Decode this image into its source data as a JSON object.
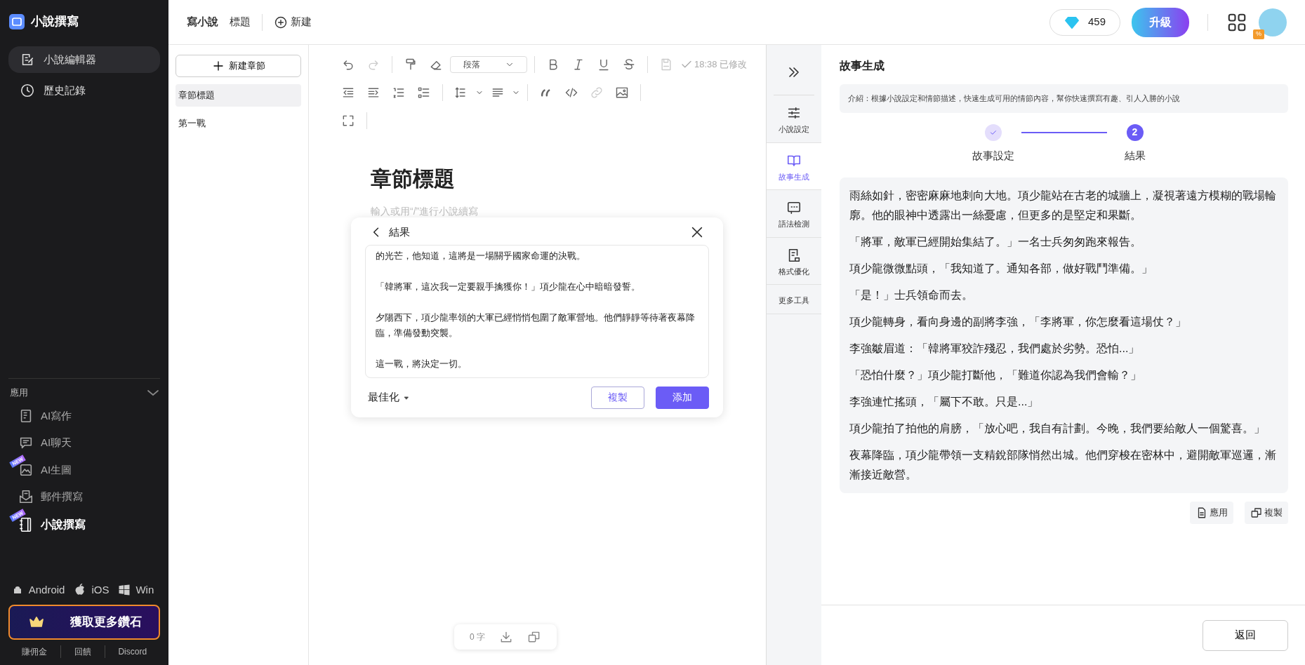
{
  "sidebar": {
    "logo_title": "小說撰寫",
    "nav": [
      {
        "label": "小說編輯器",
        "selected": true
      },
      {
        "label": "歷史記錄",
        "selected": false
      }
    ],
    "apps_header": "應用",
    "apps_expanded": true,
    "apps": [
      {
        "label": "AI寫作",
        "active": false
      },
      {
        "label": "AI聊天",
        "active": false
      },
      {
        "label": "AI生圖",
        "badge": "NEW",
        "active": false
      },
      {
        "label": "郵件撰寫",
        "active": false
      },
      {
        "label": "小說撰寫",
        "badge": "NEW",
        "active": true
      }
    ],
    "platforms": [
      "Android",
      "iOS",
      "Win"
    ],
    "promo_button": "獲取更多鑽石",
    "footer_links": [
      "賺佣金",
      "回饋",
      "Discord"
    ]
  },
  "topbar": {
    "tabs": [
      {
        "label": "寫小說",
        "selected": true
      },
      {
        "label": "標題",
        "selected": false
      }
    ],
    "new_button": "新建",
    "diamonds": "459",
    "upgrade_button": "升級",
    "avatar_badge": "%"
  },
  "chapters": {
    "new_button": "新建章節",
    "items": [
      {
        "label": "章節標題",
        "selected": true
      },
      {
        "label": "第一戰",
        "selected": false
      }
    ]
  },
  "editor": {
    "toolbar": {
      "paragraph_select": "段落",
      "save_status": "18:38 已修改",
      "redo_disabled": true,
      "link_disabled": true
    },
    "heading": "章節標題",
    "placeholder": "輸入或用“/”進行小說續寫",
    "word_count": "0 字"
  },
  "popup": {
    "title": "結果",
    "paragraphs": [
      "的光芒，他知道，這將是一場關乎國家命運的決戰。",
      "「韓將軍，這次我一定要親手擒獲你！」項少龍在心中暗暗發誓。",
      "夕陽西下，項少龍率領的大軍已經悄悄包圍了敵軍營地。他們靜靜等待著夜幕降臨，準備發動突襲。",
      "這一戰，將決定一切。"
    ],
    "mode_select": "最佳化",
    "buttons": [
      {
        "label": "複製",
        "primary": false
      },
      {
        "label": "添加",
        "primary": true
      }
    ]
  },
  "tool_rail": {
    "items": [
      {
        "label": "小說設定",
        "selected": false
      },
      {
        "label": "故事生成",
        "selected": true
      },
      {
        "label": "語法檢測",
        "selected": false
      },
      {
        "label": "格式優化",
        "selected": false
      },
      {
        "label": "更多工具",
        "selected": false
      }
    ]
  },
  "story_panel": {
    "title": "故事生成",
    "intro": "介紹：根據小說設定和情節描述，快速生成可用的情節內容，幫你快速撰寫有趣、引人入勝的小說",
    "steps": [
      {
        "label": "故事設定",
        "completed": true
      },
      {
        "label": "結果",
        "number": "2",
        "completed": false
      }
    ],
    "paragraphs": [
      "雨絲如針，密密麻麻地刺向大地。項少龍站在古老的城牆上，凝視著遠方模糊的戰場輪廓。他的眼神中透露出一絲憂慮，但更多的是堅定和果斷。",
      "「將軍，敵軍已經開始集結了。」一名士兵匆匆跑來報告。",
      "項少龍微微點頭，「我知道了。通知各部，做好戰鬥準備。」",
      "「是！」士兵領命而去。",
      "項少龍轉身，看向身邊的副將李強，「李將軍，你怎麼看這場仗？」",
      "李強皺眉道：「韓將軍狡詐殘忍，我們處於劣勢。恐怕...」",
      "「恐怕什麼？」項少龍打斷他，「難道你認為我們會輸？」",
      "李強連忙搖頭，「屬下不敢。只是...」",
      "項少龍拍了拍他的肩膀，「放心吧，我自有計劃。今晚，我們要給敵人一個驚喜。」",
      "夜幕降臨，項少龍帶領一支精銳部隊悄然出城。他們穿梭在密林中，避開敵軍巡邏，漸漸接近敵營。"
    ],
    "actions": [
      "應用",
      "複製"
    ],
    "back_button": "返回"
  }
}
